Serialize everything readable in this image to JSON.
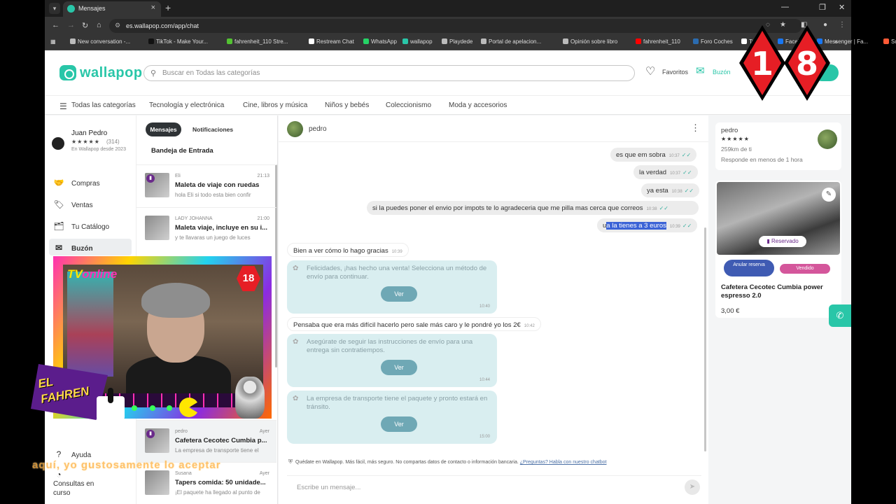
{
  "browser": {
    "tab_title": "Mensajes",
    "url": "es.wallapop.com/app/chat",
    "bookmarks": [
      {
        "label": "New conversation -...",
        "color": "#bbbbbb"
      },
      {
        "label": "TikTok - Make Your...",
        "color": "#111111"
      },
      {
        "label": "fahrenheit_110 Stre...",
        "color": "#53c232"
      },
      {
        "label": "Restream Chat",
        "color": "#ffffff"
      },
      {
        "label": "WhatsApp",
        "color": "#25d366"
      },
      {
        "label": "wallapop",
        "color": "#29c6a8"
      },
      {
        "label": "Playdede",
        "color": "#bbbbbb"
      },
      {
        "label": "Portal de apelacion...",
        "color": "#bbbbbb"
      },
      {
        "label": "Opinión sobre libro",
        "color": "#bbbbbb"
      },
      {
        "label": "fahrenheit_110",
        "color": "#ff0000"
      },
      {
        "label": "Foro Coches",
        "color": "#2b6cb0"
      },
      {
        "label": "Twitter",
        "color": "#ffffff"
      },
      {
        "label": "Facebook",
        "color": "#1877f2"
      },
      {
        "label": "Messenger | Fa...",
        "color": "#1877f2"
      },
      {
        "label": "Suno",
        "color": "#ff5a36"
      }
    ]
  },
  "header": {
    "logo": "wallapop",
    "search_placeholder": "Buscar en Todas las categorías",
    "favorites": "Favoritos",
    "inbox": "Buzón"
  },
  "categories": {
    "all": "Todas las categorías",
    "items": [
      "Tecnología y electrónica",
      "Cine, libros y música",
      "Niños y bebés",
      "Coleccionismo",
      "Moda y accesorios"
    ]
  },
  "sidebar": {
    "user_name": "Juan Pedro",
    "stars": "★★★★★",
    "reviews": "(314)",
    "since": "En Wallapop desde 2023",
    "items": [
      {
        "label": "Compras",
        "icon": "handshake-icon",
        "glyph": "🤝"
      },
      {
        "label": "Ventas",
        "icon": "tag-icon",
        "glyph": "🏷"
      },
      {
        "label": "Tu Catálogo",
        "icon": "catalog-icon",
        "glyph": "🗂"
      },
      {
        "label": "Buzón",
        "icon": "mail-icon",
        "glyph": "✉"
      }
    ],
    "help": "Ayuda",
    "consultas": "Consultas en curso"
  },
  "convlist": {
    "tab_messages": "Mensajes",
    "tab_notifications": "Notificaciones",
    "inbox_title": "Bandeja de Entrada",
    "items": [
      {
        "user": "Eli",
        "time": "21:13",
        "title": "Maleta de viaje con ruedas",
        "snippet": "hola Eli si todo esta bien confir"
      },
      {
        "user": "LADY JOHANNA",
        "time": "21:00",
        "title": "Maleta viaje, incluye en su i...",
        "snippet": "y te llavaras un juego de luces"
      },
      {
        "user": "pedro",
        "time": "Ayer",
        "title": "Cafetera Cecotec Cumbia p...",
        "snippet": "La empresa de transporte tiene el"
      },
      {
        "user": "Susana",
        "time": "Ayer",
        "title": "Tapers comida: 50 unidade...",
        "snippet": "¡El paquete ha llegado al punto de"
      }
    ]
  },
  "chat": {
    "contact": "pedro",
    "outgoing": [
      {
        "text": "es que em sobra",
        "time": "10:37"
      },
      {
        "text": "la verdad",
        "time": "10:37"
      },
      {
        "text": "ya esta",
        "time": "10:38"
      },
      {
        "text": "si la puedes poner el envio por impots te lo agradeceria que me pilla mas cerca que correos",
        "time": "10:38"
      },
      {
        "text_pre": "u",
        "text_sel": "a la tienes a 3 euros",
        "time": "10:39"
      }
    ],
    "incoming_1": {
      "text": "Bien a ver cómo lo hago gracias",
      "time": "10:39"
    },
    "system_1": {
      "text": "Felicidades, ¡has hecho una venta! Selecciona un método de envío para continuar.",
      "button": "Ver",
      "time": "10:40"
    },
    "incoming_2": {
      "text": "Pensaba que era más difícil hacerlo pero sale más caro y le pondré yo los 2€",
      "time": "10:42"
    },
    "system_2": {
      "text": "Asegúrate de seguir las instrucciones de envío para una entrega sin contratiempos.",
      "button": "Ver",
      "time": "10:44"
    },
    "system_3": {
      "text": "La empresa de transporte tiene el paquete y pronto estará en tránsito.",
      "button": "Ver",
      "time": "15:00"
    },
    "safety_note": "Quédate en Wallapop. Más fácil, más seguro. No compartas datos de contacto o información bancaria.",
    "safety_link": "¿Preguntas? Habla con nuestro chatbot",
    "compose_placeholder": "Escribe un mensaje..."
  },
  "right_panel": {
    "seller_name": "pedro",
    "seller_stars": "★★★★★",
    "distance": "259km de ti",
    "response": "Responde en menos de 1 hora",
    "reserved": "Reservado",
    "cancel_reservation": "Anular reserva",
    "sold": "Vendido",
    "product_title": "Cafetera Cecotec Cumbia power espresso 2.0",
    "price": "3,00 €"
  },
  "overlay": {
    "badge_left": "1",
    "badge_right": "8",
    "tv_online_a": "TV",
    "tv_online_b": "online",
    "mini_badge": "18",
    "logo_line1": "EL",
    "logo_line2": "FAHREN",
    "subtitle": "aquí, yo gustosamente lo aceptar"
  }
}
